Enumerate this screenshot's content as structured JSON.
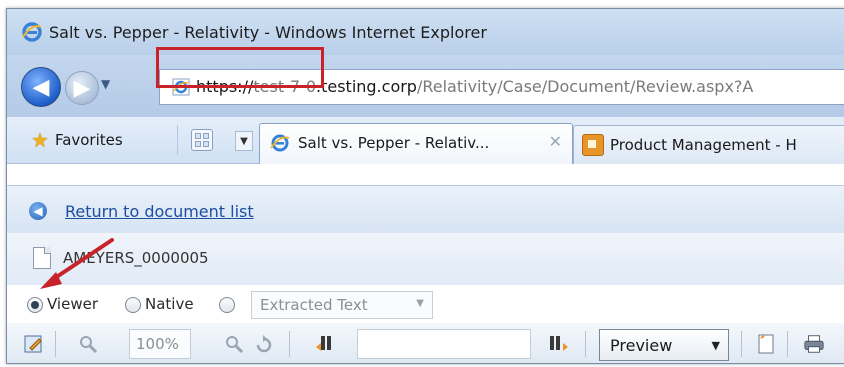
{
  "window": {
    "title": "Salt vs. Pepper - Relativity - Windows Internet Explorer"
  },
  "address_bar": {
    "protocol": "https://",
    "host_hidden": "test-7-0",
    "host_domain": ".testing.corp",
    "path": "/Relativity/Case/Document/Review.aspx?A"
  },
  "tabs": {
    "favorites_label": "Favorites",
    "items": [
      {
        "label": "Salt vs. Pepper - Relativ...",
        "close": "✕"
      },
      {
        "label": "Product Management - H"
      }
    ]
  },
  "document": {
    "return_link": "Return to document list",
    "doc_id": "AMEYERS_0000005"
  },
  "view_options": {
    "options": [
      "Viewer",
      "Native",
      ""
    ],
    "selected": "Viewer",
    "extracted_text_label": "Extracted Text"
  },
  "toolbar": {
    "zoom": "100%",
    "search_value": "",
    "mode": "Preview"
  },
  "colors": {
    "highlight": "#c8232a",
    "link": "#1d4fa0"
  }
}
